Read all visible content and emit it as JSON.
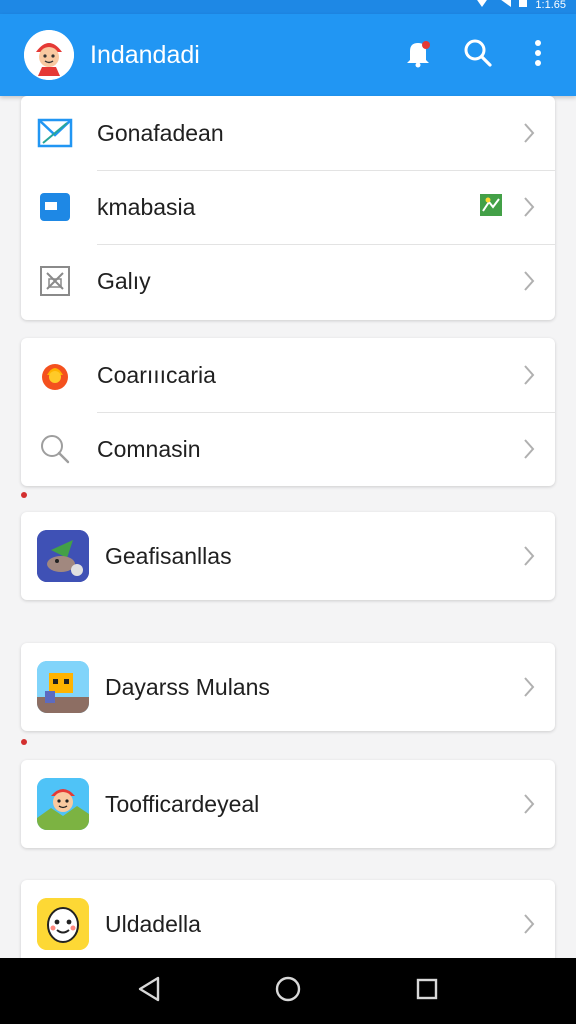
{
  "status_bar": {
    "time": "1:1.65"
  },
  "app_bar": {
    "title": "Indandadi"
  },
  "menu_group_1": [
    {
      "label": "Gonafadean",
      "icon": "mail-icon"
    },
    {
      "label": "kmabasia",
      "icon": "calendar-icon",
      "badge_icon": "image-icon"
    },
    {
      "label": "Galıy",
      "icon": "gallery-icon"
    }
  ],
  "menu_group_2": [
    {
      "label": "Coarıııcaria",
      "icon": "fire-icon"
    },
    {
      "label": "Comnasin",
      "icon": "search-icon"
    }
  ],
  "apps": [
    {
      "label": "Geafisanllas",
      "icon": "game-app-icon"
    },
    {
      "label": "Dayarss Mulans",
      "icon": "pixel-game-app-icon"
    },
    {
      "label": "Toofficardeyeal",
      "icon": "character-app-icon"
    },
    {
      "label": "Uldadella",
      "icon": "emoji-app-icon"
    }
  ],
  "colors": {
    "primary": "#2196f3",
    "status": "#1e88e5",
    "badge": "#d32f2f"
  }
}
